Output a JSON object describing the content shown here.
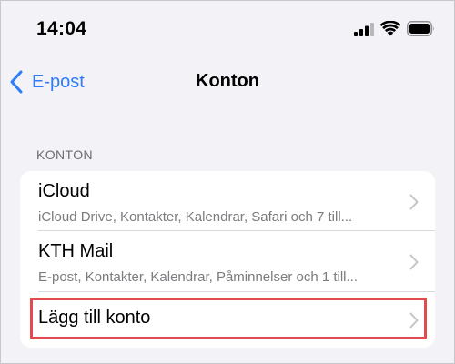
{
  "status_bar": {
    "time": "14:04",
    "icons": [
      "cellular-signal-icon",
      "wifi-icon",
      "battery-icon"
    ]
  },
  "nav": {
    "back_label": "E-post",
    "title": "Konton"
  },
  "section": {
    "header": "KONTON",
    "rows": [
      {
        "title": "iCloud",
        "subtitle": "iCloud Drive, Kontakter, Kalendrar, Safari och 7 till..."
      },
      {
        "title": "KTH Mail",
        "subtitle": "E-post, Kontakter, Kalendrar, Påminnelser och 1 till..."
      },
      {
        "title": "Lägg till konto",
        "subtitle": ""
      }
    ]
  },
  "colors": {
    "accent": "#2f7cf6",
    "background": "#f2f2f7",
    "highlight": "#e24a4f"
  }
}
